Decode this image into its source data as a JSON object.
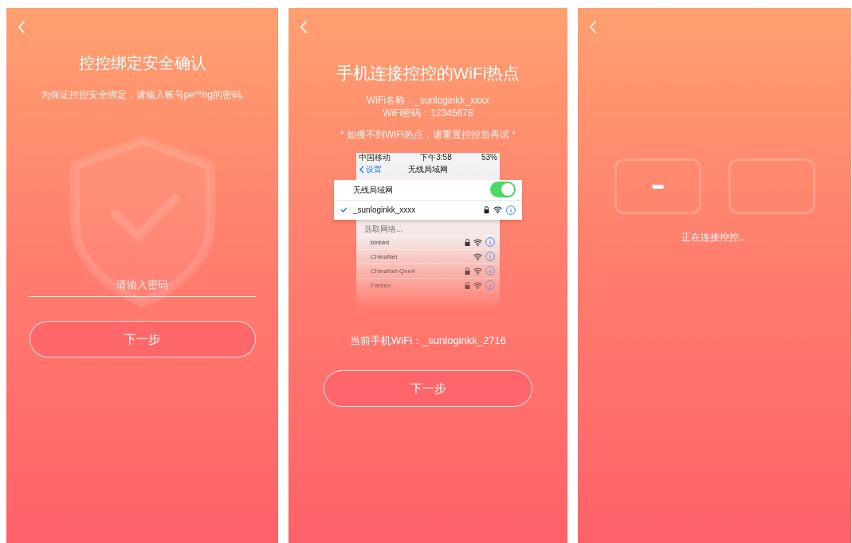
{
  "password_screen": {
    "title": "控控绑定安全确认",
    "subtitle": "为保证控控安全绑定，请输入帐号pe**ng的密码.",
    "password_field": {
      "placeholder": "请输入密码"
    },
    "next_button": "下一步"
  },
  "wifi_screen": {
    "title": "手机连接控控的WiFi热点",
    "wifi_name": "WiFi名称：_sunloginkk_xxxx",
    "wifi_password": "WiFi密码：12345678",
    "note": "* 如搜不到WiFi热点，请重置控控后再试 *",
    "phone_screenshot": {
      "carrier": "中国移动",
      "time": "下午3:58",
      "battery": "53%",
      "back_label": "设置",
      "nav_title": "无线局域网",
      "wifi_row": {
        "label": "无线局域网",
        "on": true
      },
      "current_network": {
        "name": "_sunloginkk_xxxx",
        "connected": true,
        "locked": true
      },
      "section_label": "选取网络...",
      "networks": [
        {
          "name": "binbinl",
          "locked": true
        },
        {
          "name": "ChinaNet",
          "locked": false
        },
        {
          "name": "ChinaNet-Qnn4",
          "locked": true
        },
        {
          "name": "Farben",
          "locked": true
        }
      ]
    },
    "current_wifi": "当前手机WiFi：_sunloginkk_2716",
    "next_button": "下一步"
  },
  "connecting_screen": {
    "status": "正在连接控控..."
  }
}
